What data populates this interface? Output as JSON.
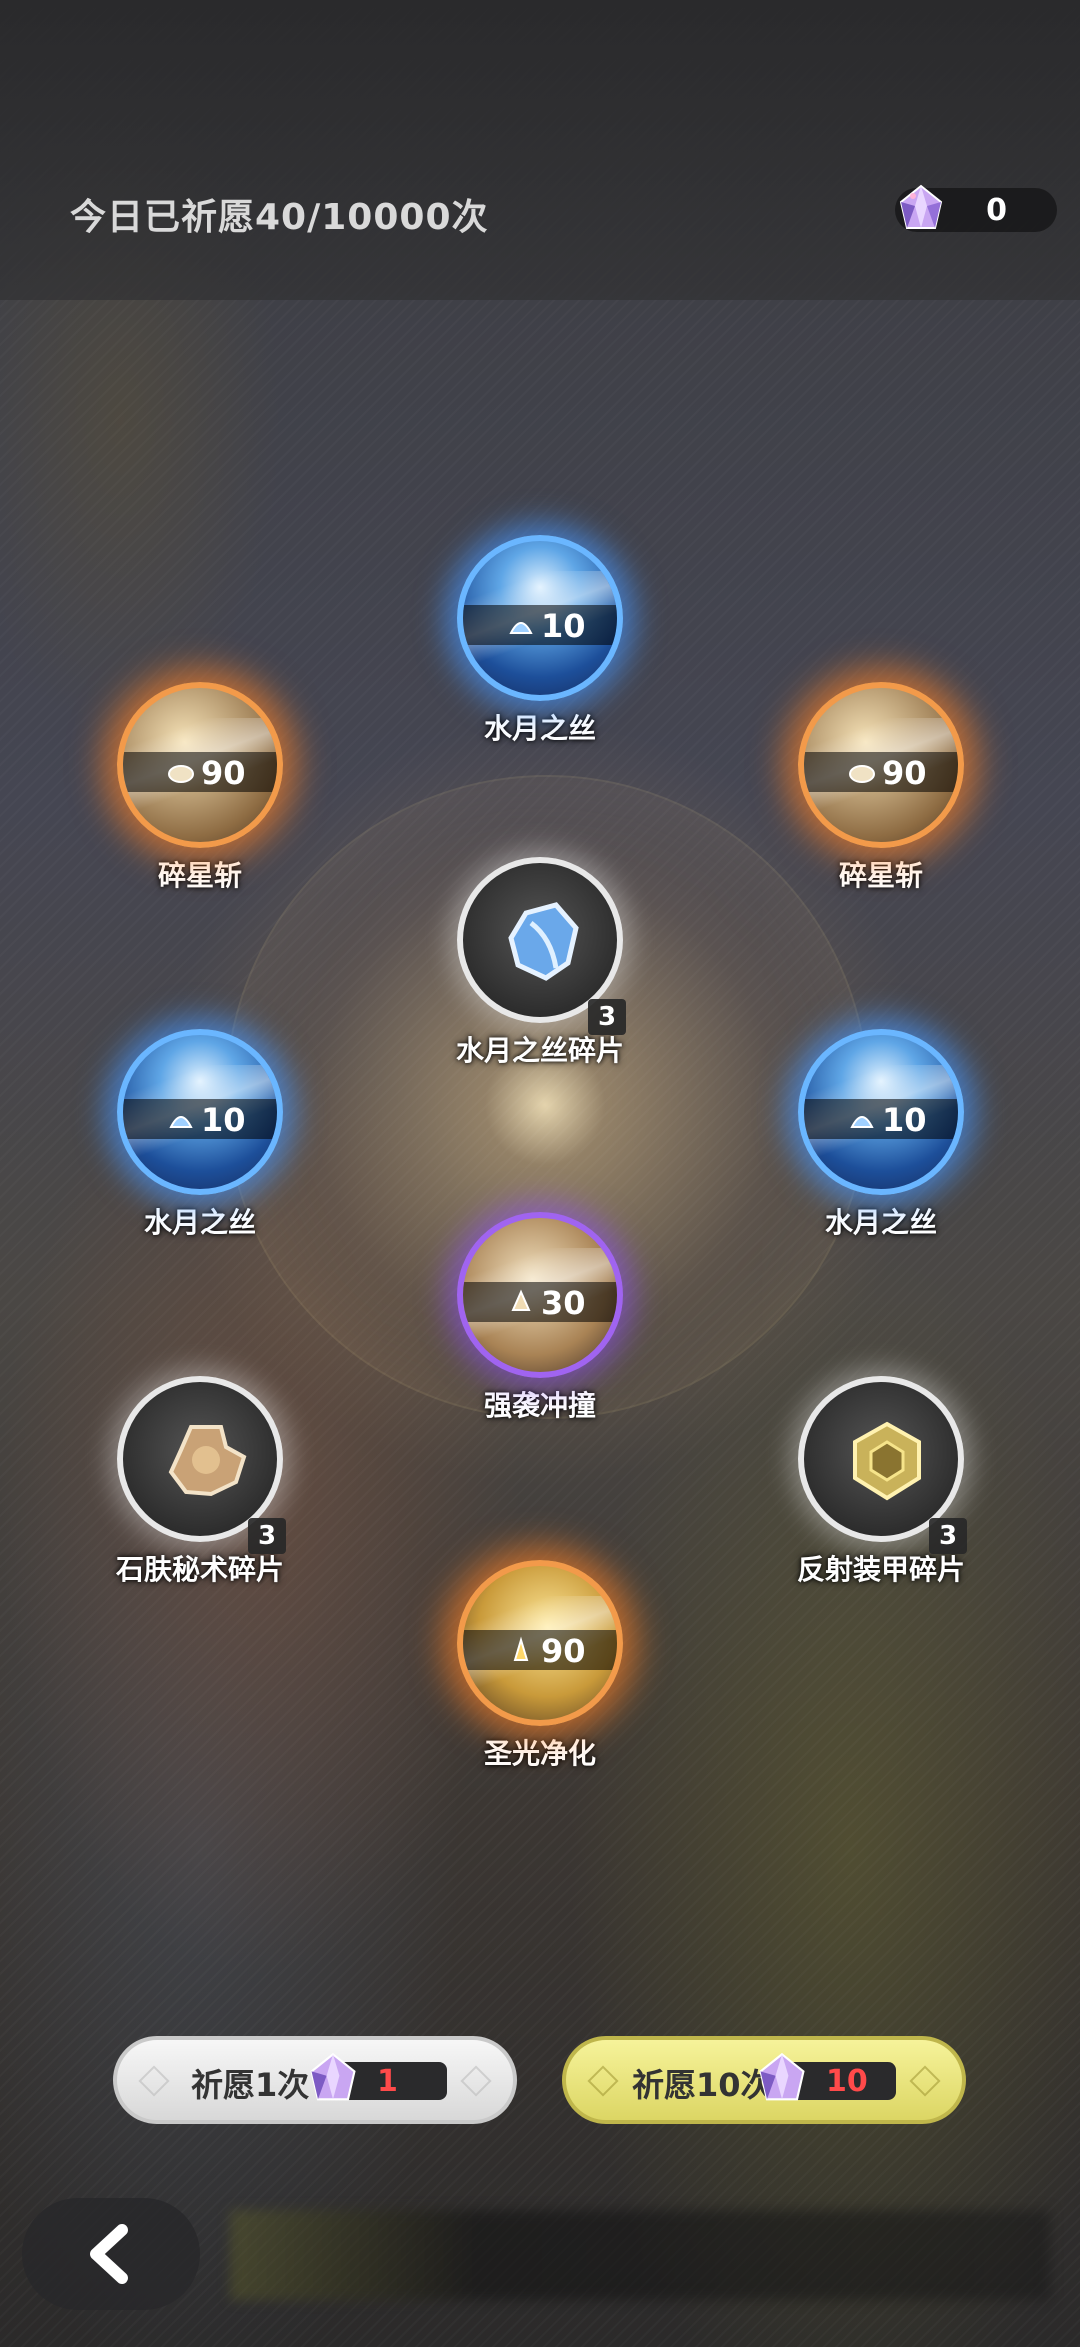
{
  "header": {
    "counter_text": "今日已祈愿40/10000次",
    "currency_amount": "0",
    "currency_icon": "crystal-gem-icon"
  },
  "items": [
    {
      "id": "top",
      "name": "水月之丝",
      "amount": "10",
      "badge": "",
      "rarity": "blue"
    },
    {
      "id": "upper-left",
      "name": "碎星斩",
      "amount": "90",
      "badge": "",
      "rarity": "orange"
    },
    {
      "id": "upper-right",
      "name": "碎星斩",
      "amount": "90",
      "badge": "",
      "rarity": "orange"
    },
    {
      "id": "center",
      "name": "水月之丝碎片",
      "amount": "",
      "badge": "3",
      "rarity": "white"
    },
    {
      "id": "mid-left",
      "name": "水月之丝",
      "amount": "10",
      "badge": "",
      "rarity": "blue"
    },
    {
      "id": "mid-right",
      "name": "水月之丝",
      "amount": "10",
      "badge": "",
      "rarity": "blue"
    },
    {
      "id": "lower-center",
      "name": "强袭冲撞",
      "amount": "30",
      "badge": "",
      "rarity": "purple"
    },
    {
      "id": "lower-left",
      "name": "石肤秘术碎片",
      "amount": "",
      "badge": "3",
      "rarity": "white"
    },
    {
      "id": "lower-right",
      "name": "反射装甲碎片",
      "amount": "",
      "badge": "3",
      "rarity": "white"
    },
    {
      "id": "bottom",
      "name": "圣光净化",
      "amount": "90",
      "badge": "",
      "rarity": "orange"
    }
  ],
  "buttons": {
    "wish_one": {
      "label": "祈愿1次",
      "cost": "1"
    },
    "wish_ten": {
      "label": "祈愿10次",
      "cost": "10"
    }
  },
  "colors": {
    "cost_text": "#ff4a4a",
    "orange_ring": "#f29a4a",
    "blue_ring": "#6ab6ff",
    "purple_ring": "#a064f0",
    "wish_ten_bg": "#f6f39a"
  }
}
